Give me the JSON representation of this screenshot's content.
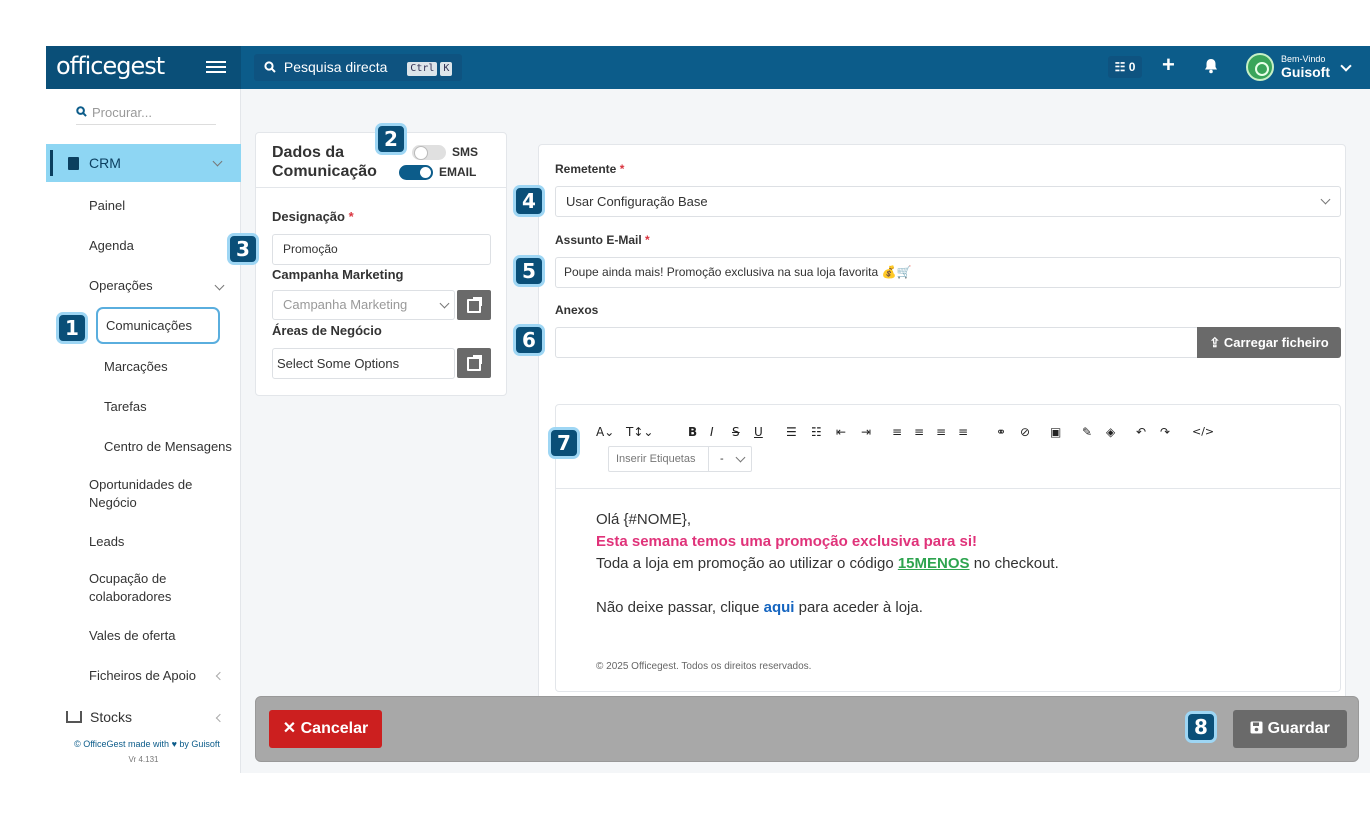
{
  "app": {
    "logo": "officegest"
  },
  "topbar": {
    "search_label": "Pesquisa directa",
    "search_key1": "Ctrl",
    "search_key2": "K",
    "tasks_label": "☷ 0",
    "plus": "+",
    "welcome": "Bem-Vindo",
    "user": "Guisoft"
  },
  "sidebar": {
    "search_placeholder": "Procurar...",
    "crm": "CRM",
    "painel": "Painel",
    "agenda": "Agenda",
    "operacoes": "Operações",
    "comunicacoes": "Comunicações",
    "marcacoes": "Marcações",
    "tarefas": "Tarefas",
    "centro": "Centro de Mensagens",
    "oportunidades": "Oportunidades de Negócio",
    "leads": "Leads",
    "ocupacao": "Ocupação de colaboradores",
    "vales": "Vales de oferta",
    "ficheiros": "Ficheiros de Apoio",
    "stocks": "Stocks",
    "credit": "© OfficeGest made with ♥ by Guisoft",
    "version": "Vr 4.131"
  },
  "badges": [
    "1",
    "2",
    "3",
    "4",
    "5",
    "6",
    "7",
    "8"
  ],
  "dados": {
    "title": "Dados da Comunicação",
    "sms": "SMS",
    "email": "EMAIL",
    "designacao_label": "Designação",
    "designacao_value": "Promoção",
    "campanha_label": "Campanha Marketing",
    "campanha_placeholder": "Campanha Marketing",
    "areas_label": "Áreas de Negócio",
    "areas_placeholder": "Select Some Options",
    "required": "*"
  },
  "form": {
    "remetente_label": "Remetente",
    "remetente_value": "Usar Configuração Base",
    "assunto_label": "Assunto E-Mail",
    "assunto_value": "Poupe ainda mais! Promoção exclusiva na sua loja favorita 💰🛒",
    "anexos_label": "Anexos",
    "upload_label": "Carregar ficheiro",
    "required": "*"
  },
  "editor": {
    "toolbar": [
      "A⌄",
      "T↕⌄",
      "B",
      "I",
      "S",
      "U",
      "☰",
      "☷",
      "⇤",
      "⇥",
      "≡",
      "≡",
      "≡",
      "≡",
      "⚭",
      "⊘",
      "▣",
      "✎",
      "◈",
      "↶",
      "↷",
      "</>"
    ],
    "tags_placeholder": "Inserir Etiquetas",
    "tags_value": "-",
    "greeting": "Olá {#NOME},",
    "headline": "Esta semana temos uma promoção exclusiva para si!",
    "line1_pre": "Toda a loja em promoção ao utilizar o código ",
    "code": "15MENOS",
    "line1_post": " no checkout.",
    "line2_pre": "Não deixe passar, clique ",
    "link": "aqui",
    "line2_post": " para aceder à loja.",
    "footnote": "© 2025 Officegest. Todos os direitos reservados.",
    "headline_color": "#e0337a",
    "code_color": "#2ea44f",
    "link_color": "#1565c0"
  },
  "actions": {
    "cancel": "Cancelar",
    "save": "Guardar"
  }
}
